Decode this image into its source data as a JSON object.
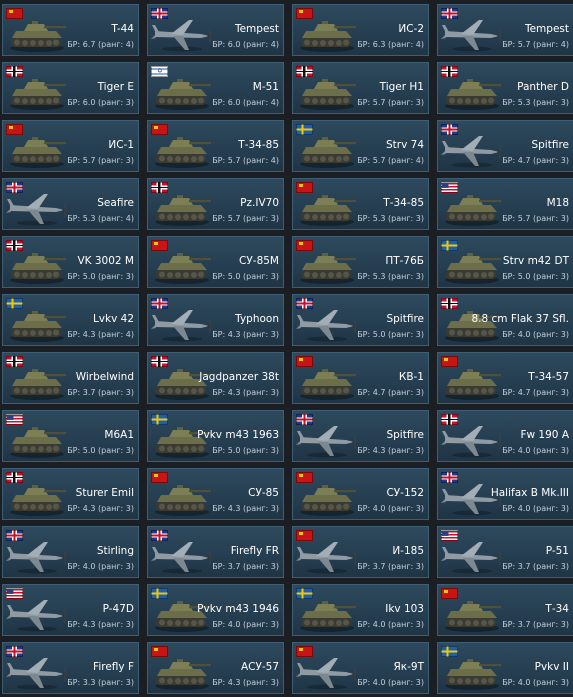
{
  "vehicles": [
    {
      "name": "T-44",
      "br": "БР: 6.7 (ранг: 4)",
      "nation": "ussr",
      "type": "tank"
    },
    {
      "name": "Tempest",
      "br": "БР: 6.0 (ранг: 4)",
      "nation": "uk",
      "type": "plane"
    },
    {
      "name": "ИС-2",
      "br": "БР: 6.3 (ранг: 4)",
      "nation": "ussr",
      "type": "tank"
    },
    {
      "name": "Tempest",
      "br": "БР: 5.7 (ранг: 4)",
      "nation": "uk",
      "type": "plane"
    },
    {
      "name": "Tiger E",
      "br": "БР: 6.0 (ранг: 3)",
      "nation": "germany",
      "type": "tank"
    },
    {
      "name": "M-51",
      "br": "БР: 6.0 (ранг: 4)",
      "nation": "israel",
      "type": "tank"
    },
    {
      "name": "Tiger H1",
      "br": "БР: 5.7 (ранг: 3)",
      "nation": "germany",
      "type": "tank"
    },
    {
      "name": "Panther D",
      "br": "БР: 5.3 (ранг: 3)",
      "nation": "germany",
      "type": "tank"
    },
    {
      "name": "ИС-1",
      "br": "БР: 5.7 (ранг: 3)",
      "nation": "ussr",
      "type": "tank"
    },
    {
      "name": "Т-34-85",
      "br": "БР: 5.7 (ранг: 4)",
      "nation": "ussr",
      "type": "tank"
    },
    {
      "name": "Strv 74",
      "br": "БР: 5.7 (ранг: 4)",
      "nation": "sweden",
      "type": "tank"
    },
    {
      "name": "Spitfire",
      "br": "БР: 4.7 (ранг: 3)",
      "nation": "uk",
      "type": "plane"
    },
    {
      "name": "Seafire",
      "br": "БР: 5.3 (ранг: 4)",
      "nation": "uk",
      "type": "plane"
    },
    {
      "name": "Pz.IV70",
      "br": "БР: 5.7 (ранг: 3)",
      "nation": "germany",
      "type": "tank"
    },
    {
      "name": "Т-34-85",
      "br": "БР: 5.3 (ранг: 3)",
      "nation": "ussr",
      "type": "tank"
    },
    {
      "name": "M18",
      "br": "БР: 5.7 (ранг: 3)",
      "nation": "usa",
      "type": "tank"
    },
    {
      "name": "VK 3002 M",
      "br": "БР: 5.0 (ранг: 3)",
      "nation": "germany",
      "type": "tank"
    },
    {
      "name": "СУ-85М",
      "br": "БР: 5.0 (ранг: 3)",
      "nation": "ussr",
      "type": "tank"
    },
    {
      "name": "ПТ-76Б",
      "br": "БР: 5.3 (ранг: 3)",
      "nation": "ussr",
      "type": "tank"
    },
    {
      "name": "Strv m42 DT",
      "br": "БР: 5.0 (ранг: 3)",
      "nation": "sweden",
      "type": "tank"
    },
    {
      "name": "Lvkv 42",
      "br": "БР: 4.3 (ранг: 4)",
      "nation": "sweden",
      "type": "tank"
    },
    {
      "name": "Typhoon",
      "br": "БР: 4.3 (ранг: 3)",
      "nation": "uk",
      "type": "plane"
    },
    {
      "name": "Spitfire",
      "br": "БР: 5.0 (ранг: 3)",
      "nation": "uk",
      "type": "plane"
    },
    {
      "name": "8.8 cm Flak 37 Sfl.",
      "br": "БР: 4.0 (ранг: 3)",
      "nation": "germany",
      "type": "tank"
    },
    {
      "name": "Wirbelwind",
      "br": "БР: 3.7 (ранг: 3)",
      "nation": "germany",
      "type": "tank"
    },
    {
      "name": "Jagdpanzer 38t",
      "br": "БР: 4.3 (ранг: 3)",
      "nation": "germany",
      "type": "tank"
    },
    {
      "name": "КВ-1",
      "br": "БР: 4.7 (ранг: 3)",
      "nation": "ussr",
      "type": "tank"
    },
    {
      "name": "Т-34-57",
      "br": "БР: 4.7 (ранг: 3)",
      "nation": "ussr",
      "type": "tank"
    },
    {
      "name": "M6A1",
      "br": "БР: 5.0 (ранг: 3)",
      "nation": "usa",
      "type": "tank"
    },
    {
      "name": "Pvkv m43 1963",
      "br": "БР: 5.0 (ранг: 3)",
      "nation": "sweden",
      "type": "tank"
    },
    {
      "name": "Spitfire",
      "br": "БР: 4.3 (ранг: 3)",
      "nation": "uk",
      "type": "plane"
    },
    {
      "name": "Fw 190 A",
      "br": "БР: 4.0 (ранг: 3)",
      "nation": "germany",
      "type": "plane"
    },
    {
      "name": "Sturer Emil",
      "br": "БР: 4.3 (ранг: 3)",
      "nation": "germany",
      "type": "tank"
    },
    {
      "name": "СУ-85",
      "br": "БР: 4.3 (ранг: 3)",
      "nation": "ussr",
      "type": "tank"
    },
    {
      "name": "СУ-152",
      "br": "БР: 4.0 (ранг: 3)",
      "nation": "ussr",
      "type": "tank"
    },
    {
      "name": "Halifax B Mk.III",
      "br": "БР: 4.0 (ранг: 3)",
      "nation": "uk",
      "type": "plane"
    },
    {
      "name": "Stirling",
      "br": "БР: 4.0 (ранг: 3)",
      "nation": "uk",
      "type": "plane"
    },
    {
      "name": "Firefly FR",
      "br": "БР: 3.7 (ранг: 3)",
      "nation": "uk",
      "type": "plane"
    },
    {
      "name": "И-185",
      "br": "БР: 3.7 (ранг: 3)",
      "nation": "ussr",
      "type": "plane"
    },
    {
      "name": "P-51",
      "br": "БР: 3.7 (ранг: 3)",
      "nation": "usa",
      "type": "plane"
    },
    {
      "name": "P-47D",
      "br": "БР: 4.3 (ранг: 3)",
      "nation": "usa",
      "type": "plane"
    },
    {
      "name": "Pvkv m43 1946",
      "br": "БР: 4.0 (ранг: 3)",
      "nation": "sweden",
      "type": "tank"
    },
    {
      "name": "Ikv 103",
      "br": "БР: 4.0 (ранг: 3)",
      "nation": "sweden",
      "type": "tank"
    },
    {
      "name": "Т-34",
      "br": "БР: 3.7 (ранг: 3)",
      "nation": "ussr",
      "type": "tank"
    },
    {
      "name": "Firefly F",
      "br": "БР: 3.3 (ранг: 3)",
      "nation": "uk",
      "type": "plane"
    },
    {
      "name": "АСУ-57",
      "br": "БР: 4.3 (ранг: 3)",
      "nation": "ussr",
      "type": "tank"
    },
    {
      "name": "Як-9Т",
      "br": "БР: 4.0 (ранг: 3)",
      "nation": "ussr",
      "type": "plane"
    },
    {
      "name": "Pvkv II",
      "br": "БР: 4.0 (ранг: 3)",
      "nation": "sweden",
      "type": "tank"
    }
  ],
  "colors": {
    "card_top": "#2e4a5e",
    "card_bottom": "#1f3546",
    "card_border": "#3e5e73",
    "name_text": "#ffffff",
    "br_text": "#c4d0da"
  }
}
